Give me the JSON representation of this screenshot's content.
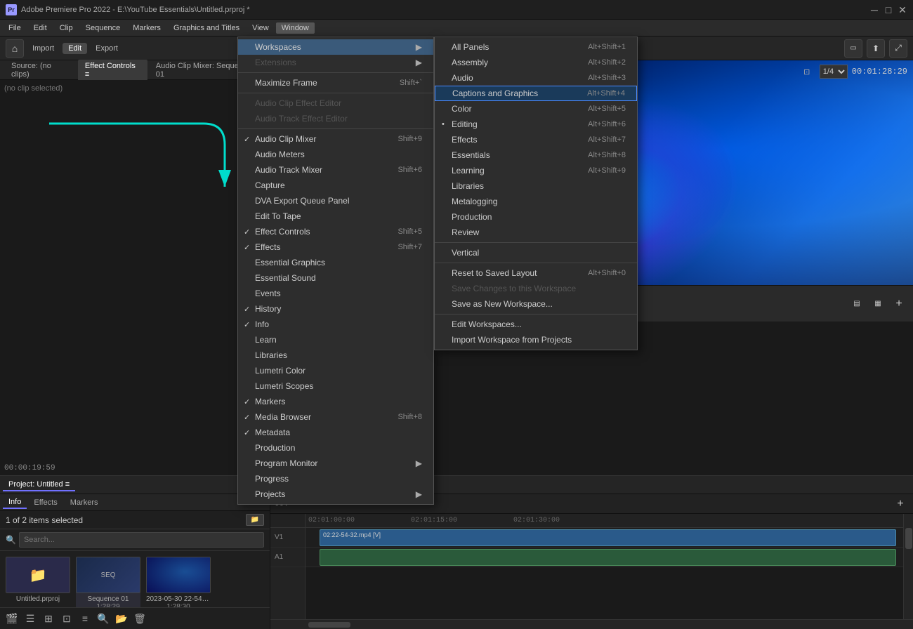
{
  "titlebar": {
    "logo": "Pr",
    "title": "Adobe Premiere Pro 2022 - E:\\YouTube Essentials\\Untitled.prproj *",
    "minimize": "─",
    "maximize": "□",
    "close": "✕"
  },
  "menubar": {
    "items": [
      "File",
      "Edit",
      "Clip",
      "Sequence",
      "Markers",
      "Graphics and Titles",
      "View",
      "Window"
    ]
  },
  "toolbar": {
    "home_label": "⌂",
    "import_label": "Import",
    "edit_label": "Edit",
    "export_label": "Export"
  },
  "source_panel": {
    "title": "Source: (no clips)",
    "tab1": "Effect Controls ≡",
    "tab2": "Audio Clip Mixer: Sequence 01",
    "no_clip": "(no clip selected)",
    "timecode": "00:00:19:59"
  },
  "preview": {
    "timecode": "00:01:28:29",
    "fraction": "1/4"
  },
  "project_panel": {
    "title": "Project: Untitled ≡",
    "tabs": [
      "Info",
      "Effects",
      "Markers"
    ],
    "items_count": "1 of 2 items selected",
    "items": [
      {
        "label": "Untitled.prproj",
        "type": "project"
      },
      {
        "label": "Sequence 01",
        "duration": "1:28:29",
        "type": "sequence"
      },
      {
        "label": "2023-05-30 22-54-32...",
        "duration": "1:28:30",
        "type": "clip"
      }
    ]
  },
  "timeline": {
    "tab": "Sequence 01",
    "timecode": "00:",
    "ruler_marks": [
      "02:01:00:00",
      "02:01:15:00",
      "02:01:30:00"
    ],
    "tracks": [
      {
        "label": "V1",
        "clip": "02:22-54-32.mp4 [V]",
        "type": "video"
      },
      {
        "label": "A1",
        "type": "audio"
      }
    ]
  },
  "window_menu": {
    "items": [
      {
        "label": "Workspaces",
        "has_arrow": true,
        "section": 1,
        "submenu_open": true
      },
      {
        "label": "Extensions",
        "has_arrow": true,
        "section": 1,
        "disabled": true
      },
      {
        "label": "Maximize Frame",
        "shortcut": "Shift+`",
        "section": 2
      },
      {
        "label": "Audio Clip Effect Editor",
        "section": 3,
        "disabled": true
      },
      {
        "label": "Audio Track Effect Editor",
        "section": 3,
        "disabled": true
      },
      {
        "label": "Audio Clip Mixer",
        "shortcut": "Shift+9",
        "check": true,
        "section": 4
      },
      {
        "label": "Audio Meters",
        "section": 4
      },
      {
        "label": "Audio Track Mixer",
        "shortcut": "Shift+6",
        "section": 4
      },
      {
        "label": "Capture",
        "section": 4
      },
      {
        "label": "DVA Export Queue Panel",
        "section": 4
      },
      {
        "label": "Edit To Tape",
        "section": 4
      },
      {
        "label": "Effect Controls",
        "shortcut": "Shift+5",
        "check": true,
        "section": 4
      },
      {
        "label": "Effects",
        "shortcut": "Shift+7",
        "check": true,
        "section": 4
      },
      {
        "label": "Essential Graphics",
        "section": 4
      },
      {
        "label": "Essential Sound",
        "section": 4
      },
      {
        "label": "Events",
        "section": 4
      },
      {
        "label": "History",
        "check": true,
        "section": 4
      },
      {
        "label": "Info",
        "check": true,
        "section": 4
      },
      {
        "label": "Learn",
        "section": 4
      },
      {
        "label": "Libraries",
        "section": 4
      },
      {
        "label": "Lumetri Color",
        "section": 4
      },
      {
        "label": "Lumetri Scopes",
        "section": 4
      },
      {
        "label": "Markers",
        "check": true,
        "section": 4
      },
      {
        "label": "Media Browser",
        "shortcut": "Shift+8",
        "check": true,
        "section": 4
      },
      {
        "label": "Metadata",
        "check": true,
        "section": 4
      },
      {
        "label": "Production",
        "section": 4
      },
      {
        "label": "Program Monitor",
        "has_arrow": true,
        "section": 4
      },
      {
        "label": "Progress",
        "section": 4
      },
      {
        "label": "Projects",
        "has_arrow": true,
        "section": 4
      }
    ]
  },
  "workspaces_menu": {
    "items": [
      {
        "label": "All Panels",
        "shortcut": "Alt+Shift+1",
        "section": 1
      },
      {
        "label": "Assembly",
        "shortcut": "Alt+Shift+2",
        "section": 1
      },
      {
        "label": "Audio",
        "shortcut": "Alt+Shift+3",
        "section": 1
      },
      {
        "label": "Captions and Graphics",
        "shortcut": "Alt+Shift+4",
        "section": 1,
        "highlighted": true
      },
      {
        "label": "Color",
        "shortcut": "Alt+Shift+5",
        "section": 1
      },
      {
        "label": "Editing",
        "shortcut": "Alt+Shift+6",
        "section": 1,
        "bullet": true
      },
      {
        "label": "Effects",
        "shortcut": "Alt+Shift+7",
        "section": 1
      },
      {
        "label": "Essentials",
        "shortcut": "Alt+Shift+8",
        "section": 1
      },
      {
        "label": "Learning",
        "shortcut": "Alt+Shift+9",
        "section": 1
      },
      {
        "label": "Libraries",
        "section": 1
      },
      {
        "label": "Metalogging",
        "section": 1
      },
      {
        "label": "Production",
        "section": 1
      },
      {
        "label": "Review",
        "section": 1
      },
      {
        "label": "Vertical",
        "section": 2
      },
      {
        "label": "Reset to Saved Layout",
        "shortcut": "Alt+Shift+0",
        "section": 3
      },
      {
        "label": "Save Changes to this Workspace",
        "disabled": true,
        "section": 3
      },
      {
        "label": "Save as New Workspace...",
        "section": 3
      },
      {
        "label": "Edit Workspaces...",
        "section": 4
      },
      {
        "label": "Import Workspace from Projects",
        "section": 4
      }
    ]
  }
}
